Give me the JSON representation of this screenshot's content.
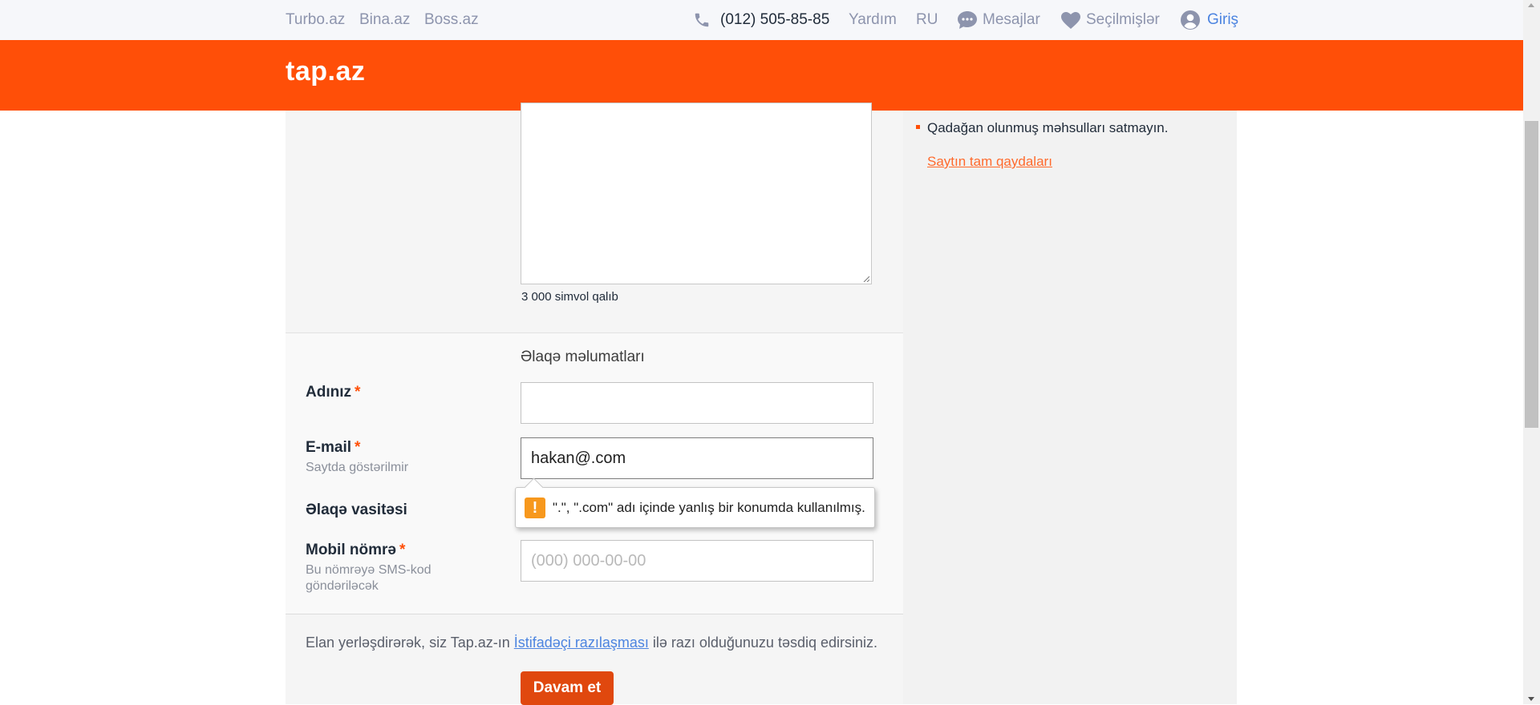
{
  "topbar": {
    "links": [
      "Turbo.az",
      "Bina.az",
      "Boss.az"
    ],
    "phone": "(012) 505-85-85",
    "help": "Yardım",
    "language": "RU",
    "messages": "Mesajlar",
    "favorites": "Seçilmişlər",
    "login": "Giriş"
  },
  "header": {
    "logo": "tap.az"
  },
  "description": {
    "chars_left": "3 000 simvol qalıb"
  },
  "contact": {
    "section_title": "Əlaqə məlumatları",
    "name_label": "Adınız",
    "required_mark": "*",
    "email_label": "E-mail",
    "email_hint": "Saytda göstərilmir",
    "email_value": "hakan@.com",
    "contact_method_label": "Əlaqə vasitəsi",
    "phone_label": "Mobil nömrə",
    "phone_hint": "Bu nömrəyə SMS-kod göndəriləcək",
    "phone_placeholder": "(000) 000-00-00"
  },
  "validation": {
    "message": "\".\", \".com\" adı içinde yanlış bir konumda kullanılmış.",
    "icon": "warning-icon",
    "color": "#f7981d"
  },
  "agreement": {
    "before": "Elan yerləşdirərək, siz Tap.az-ın ",
    "link": "İstifadəçi razılaşması",
    "after": " ilə razı olduğunuzu təsdiq edirsiniz."
  },
  "submit": {
    "label": "Davam et"
  },
  "sidebar": {
    "rule": "Qadağan olunmuş məhsulları satmayın.",
    "rules_link": "Saytın tam qaydaları"
  },
  "colors": {
    "brand": "#ff4f08",
    "link": "#4c84e0",
    "button": "#e0480e"
  }
}
